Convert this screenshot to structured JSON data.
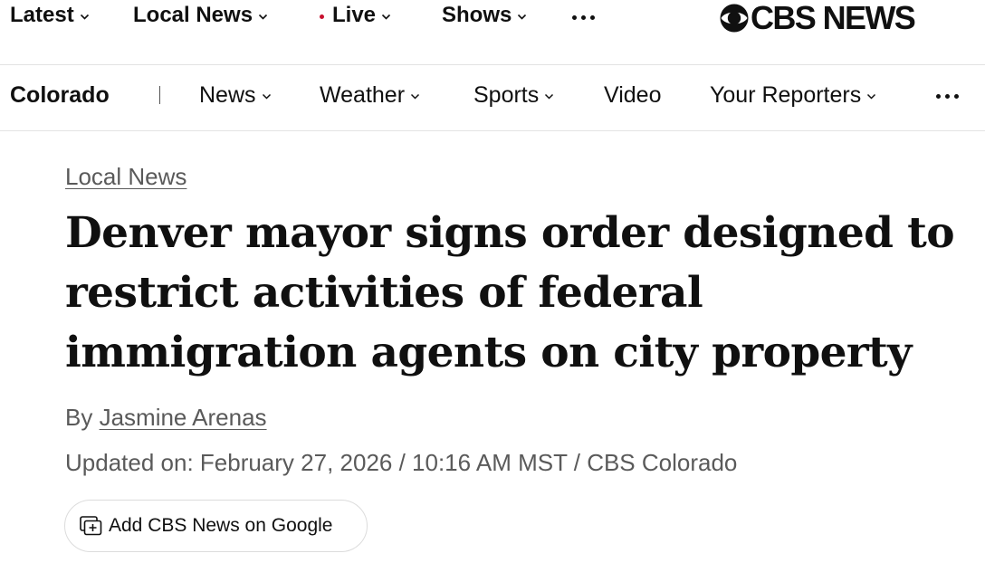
{
  "top_nav": {
    "items": [
      {
        "label": "Latest"
      },
      {
        "label": "Local News"
      },
      {
        "label": "Live"
      },
      {
        "label": "Shows"
      }
    ],
    "logo_text": "CBS NEWS",
    "more_icon": "ellipsis-icon"
  },
  "sub_nav": {
    "section": "Colorado",
    "items": [
      {
        "label": "News"
      },
      {
        "label": "Weather"
      },
      {
        "label": "Sports"
      },
      {
        "label": "Video"
      },
      {
        "label": "Your Reporters"
      }
    ],
    "more_icon": "ellipsis-icon"
  },
  "article": {
    "kicker": "Local News",
    "headline": "Denver mayor signs order designed to restrict activities of federal immigration agents on city property",
    "byline_prefix": "By",
    "author": "Jasmine Arenas",
    "updated": "Updated on: February 27, 2026 / 10:16 AM MST / CBS Colorado",
    "google_button": "Add CBS News on Google"
  },
  "colors": {
    "live_dot": "#c8102e",
    "text": "#101010",
    "muted": "#5a5a5a"
  }
}
